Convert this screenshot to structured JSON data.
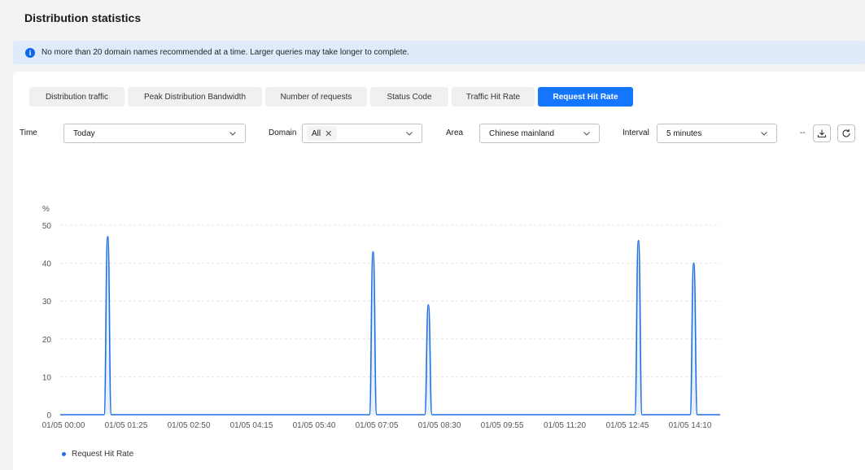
{
  "page_title": "Distribution statistics",
  "notice": {
    "text": "No more than 20 domain names recommended at a time. Larger queries may take longer to complete."
  },
  "tabs": [
    {
      "label": "Distribution traffic",
      "active": false
    },
    {
      "label": "Peak Distribution Bandwidth",
      "active": false
    },
    {
      "label": "Number of requests",
      "active": false
    },
    {
      "label": "Status Code",
      "active": false
    },
    {
      "label": "Traffic Hit Rate",
      "active": false
    },
    {
      "label": "Request Hit Rate",
      "active": true
    }
  ],
  "filters": {
    "time_label": "Time",
    "time_value": "Today",
    "domain_label": "Domain",
    "domain_tag": "All",
    "area_label": "Area",
    "area_value": "Chinese mainland",
    "interval_label": "Interval",
    "interval_value": "5 minutes",
    "dashes": "--"
  },
  "icons": [
    "info-icon",
    "chevron-down-icon",
    "close-icon",
    "download-icon",
    "refresh-icon"
  ],
  "colors": {
    "accent": "#1476ff",
    "series": "#1f6fe6",
    "notice_bg": "#dfeafb"
  },
  "chart_data": {
    "type": "line",
    "ylabel": "%",
    "ylim": [
      0,
      50
    ],
    "yticks": [
      "0",
      "10",
      "20",
      "30",
      "40",
      "50"
    ],
    "x_tick_labels": [
      "01/05 00:00",
      "01/05 01:25",
      "01/05 02:50",
      "01/05 04:15",
      "01/05 05:40",
      "01/05 07:05",
      "01/05 08:30",
      "01/05 09:55",
      "01/05 11:20",
      "01/05 12:45",
      "01/05 14:10"
    ],
    "grid": true,
    "legend_position": "bottom-left",
    "series": [
      {
        "name": "Request Hit Rate",
        "peaks": [
          {
            "x": "01/05 01:00",
            "y": 47
          },
          {
            "x": "01/05 07:00",
            "y": 43
          },
          {
            "x": "01/05 08:15",
            "y": 29
          },
          {
            "x": "01/05 13:00",
            "y": 46
          },
          {
            "x": "01/05 14:15",
            "y": 40
          }
        ],
        "baseline": 0
      }
    ]
  }
}
